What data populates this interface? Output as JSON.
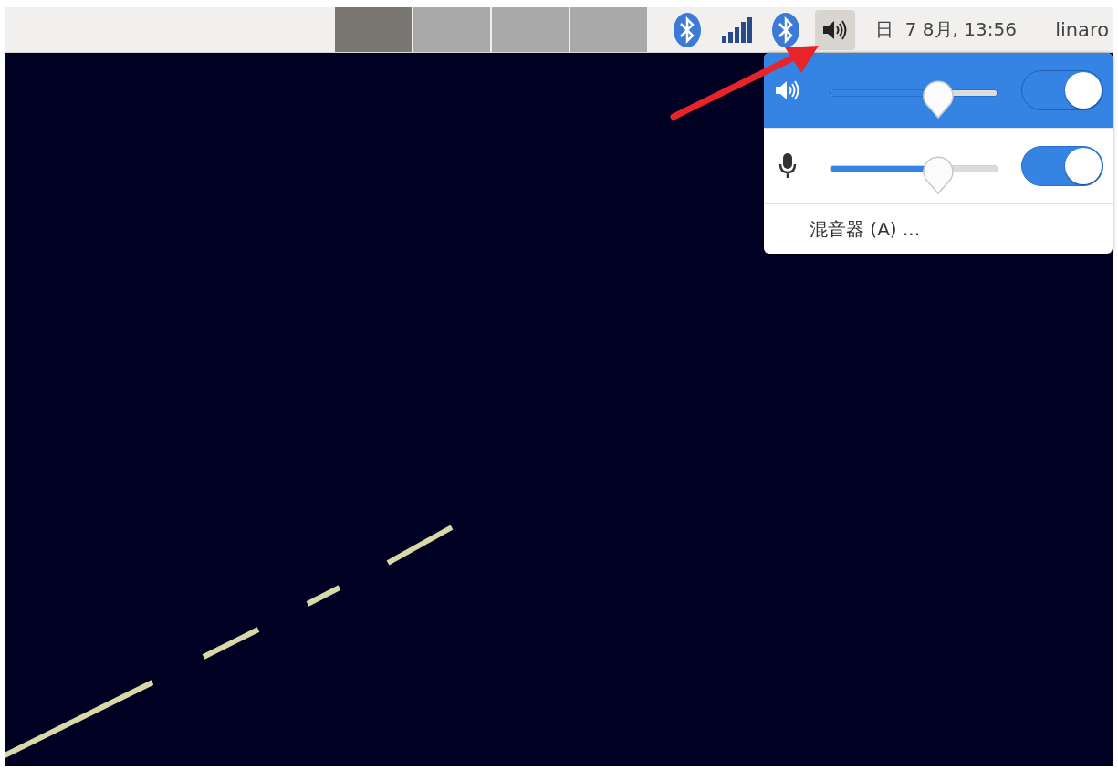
{
  "top_bar": {
    "workspaces": [
      {
        "selected": true
      },
      {
        "selected": false
      },
      {
        "selected": false
      },
      {
        "selected": false
      }
    ],
    "tray": [
      {
        "kind": "bluetooth",
        "active": false
      },
      {
        "kind": "signal",
        "active": false
      },
      {
        "kind": "bluetooth",
        "active": false
      },
      {
        "kind": "volume",
        "active": true
      }
    ],
    "clock": "日  7 8月, 13:56",
    "user": "linaro"
  },
  "volume_menu": {
    "rows": [
      {
        "kind": "speaker",
        "level": 0.65,
        "on": true,
        "selected": true
      },
      {
        "kind": "microphone",
        "level": 0.65,
        "on": true,
        "selected": false
      }
    ],
    "mixer_item": "混音器 (A) ..."
  }
}
